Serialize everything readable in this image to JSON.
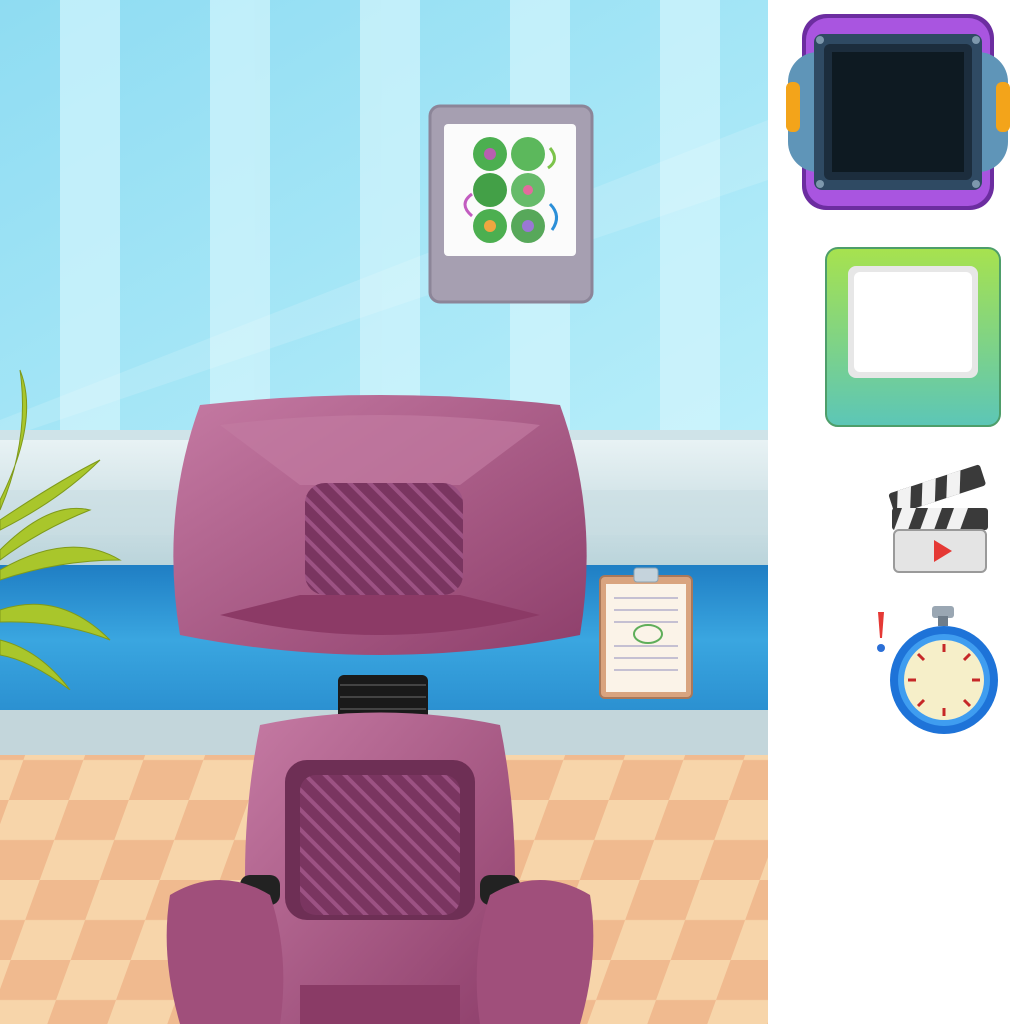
{
  "scene": {
    "name": "eye-exam-room",
    "colors": {
      "wall_light": "#a9e8f7",
      "wall_stripe": "#d6f6fc",
      "wainscot": "#2f9bd6",
      "floor_light": "#f7d6a8",
      "floor_dark": "#eaa97d",
      "chair": "#a6547f",
      "chair_dark": "#6e2f55",
      "chair_light": "#c77aa1"
    },
    "icons": [
      "color-blind-test-poster-icon",
      "clipboard-icon",
      "plant-icon",
      "exam-chair-icon"
    ]
  },
  "side_assets": {
    "items": [
      {
        "name": "tv-frame-icon",
        "accent": "#8f3fc7",
        "screen": "#0e1a22"
      },
      {
        "name": "green-frame-icon",
        "accent": "#9bdc4a"
      },
      {
        "name": "clapperboard-icon",
        "accent": "#e53935"
      },
      {
        "name": "stopwatch-icon",
        "accent": "#1e73d8"
      }
    ]
  }
}
